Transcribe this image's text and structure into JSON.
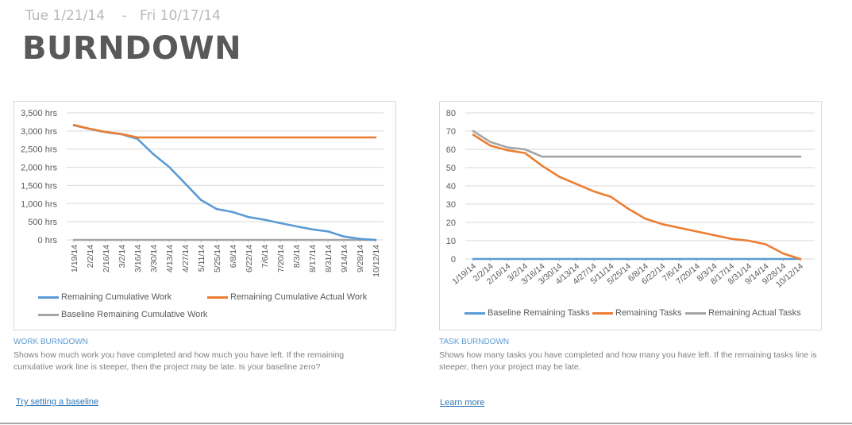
{
  "header": {
    "date_start": "Tue 1/21/14",
    "date_separator": "-",
    "date_end": "Fri 10/17/14",
    "title": "BURNDOWN"
  },
  "colors": {
    "blue": "#5b9bd5",
    "orange": "#ed7d31",
    "gray": "#a5a5a5",
    "accent_text": "#5b9bd5",
    "link": "#2e75b6"
  },
  "chart_data": [
    {
      "type": "line",
      "title": "Work Burndown",
      "xlabel": "",
      "ylabel": "",
      "ylim": [
        0,
        3500
      ],
      "yticks": [
        0,
        500,
        1000,
        1500,
        2000,
        2500,
        3000,
        3500
      ],
      "ytick_labels": [
        "0 hrs",
        "500 hrs",
        "1,000 hrs",
        "1,500 hrs",
        "2,000 hrs",
        "2,500 hrs",
        "3,000 hrs",
        "3,500 hrs"
      ],
      "grid": true,
      "legend_position": "bottom",
      "x": [
        "1/19/14",
        "2/2/14",
        "2/16/14",
        "3/2/14",
        "3/16/14",
        "3/30/14",
        "4/13/14",
        "4/27/14",
        "5/11/14",
        "5/25/14",
        "6/8/14",
        "6/22/14",
        "7/6/14",
        "7/20/14",
        "8/3/14",
        "8/17/14",
        "8/31/14",
        "9/14/14",
        "9/28/14",
        "10/12/14"
      ],
      "series": [
        {
          "name": "Remaining Cumulative Work",
          "color": "#5b9bd5",
          "values": [
            3157,
            3055,
            2967,
            2910,
            2785,
            2362,
            2011,
            1557,
            1100,
            849,
            768,
            629,
            555,
            461,
            373,
            292,
            234,
            94,
            29,
            0
          ]
        },
        {
          "name": "Remaining Cumulative Actual Work",
          "color": "#ed7d31",
          "values": [
            3165,
            3060,
            2972,
            2915,
            2822,
            2822,
            2822,
            2822,
            2822,
            2822,
            2822,
            2822,
            2822,
            2822,
            2822,
            2822,
            2822,
            2822,
            2822,
            2822
          ]
        },
        {
          "name": "Baseline Remaining Cumulative Work",
          "color": "#a5a5a5",
          "values": [
            0,
            0,
            0,
            0,
            0,
            0,
            0,
            0,
            0,
            0,
            0,
            0,
            0,
            0,
            0,
            0,
            0,
            0,
            0,
            0
          ]
        }
      ]
    },
    {
      "type": "line",
      "title": "Task Burndown",
      "xlabel": "",
      "ylabel": "",
      "ylim": [
        0,
        80
      ],
      "yticks": [
        0,
        10,
        20,
        30,
        40,
        50,
        60,
        70,
        80
      ],
      "ytick_labels": [
        "0",
        "10",
        "20",
        "30",
        "40",
        "50",
        "60",
        "70",
        "80"
      ],
      "grid": true,
      "legend_position": "bottom",
      "x": [
        "1/19/14",
        "2/2/14",
        "2/16/14",
        "3/2/14",
        "3/16/14",
        "3/30/14",
        "4/13/14",
        "4/27/14",
        "5/11/14",
        "5/25/14",
        "6/8/14",
        "6/22/14",
        "7/6/14",
        "7/20/14",
        "8/3/14",
        "8/17/14",
        "8/31/14",
        "9/14/14",
        "9/28/14",
        "10/12/14"
      ],
      "series": [
        {
          "name": "Baseline Remaining Tasks",
          "color": "#5b9bd5",
          "values": [
            0,
            0,
            0,
            0,
            0,
            0,
            0,
            0,
            0,
            0,
            0,
            0,
            0,
            0,
            0,
            0,
            0,
            0,
            0,
            0
          ]
        },
        {
          "name": "Remaining Tasks",
          "color": "#ed7d31",
          "values": [
            68,
            62,
            59.5,
            58,
            51,
            45,
            41,
            37,
            34,
            27.5,
            22,
            19,
            17,
            15,
            13,
            11,
            10,
            8,
            3,
            0
          ]
        },
        {
          "name": "Remaining Actual Tasks",
          "color": "#a5a5a5",
          "values": [
            70,
            64,
            61,
            60,
            56,
            56,
            56,
            56,
            56,
            56,
            56,
            56,
            56,
            56,
            56,
            56,
            56,
            56,
            56,
            56
          ]
        }
      ]
    }
  ],
  "sections": {
    "work": {
      "title": "WORK BURNDOWN",
      "description": "Shows how much work you have completed and how much you have left. If the remaining cumulative work line is steeper, then the project may be late. Is your baseline zero?",
      "link": "Try setting a baseline"
    },
    "task": {
      "title": "TASK BURNDOWN",
      "description": "Shows how many tasks you have completed and how many you have left. If the remaining tasks line is steeper, then your project may be late.",
      "link": "Learn more"
    }
  }
}
